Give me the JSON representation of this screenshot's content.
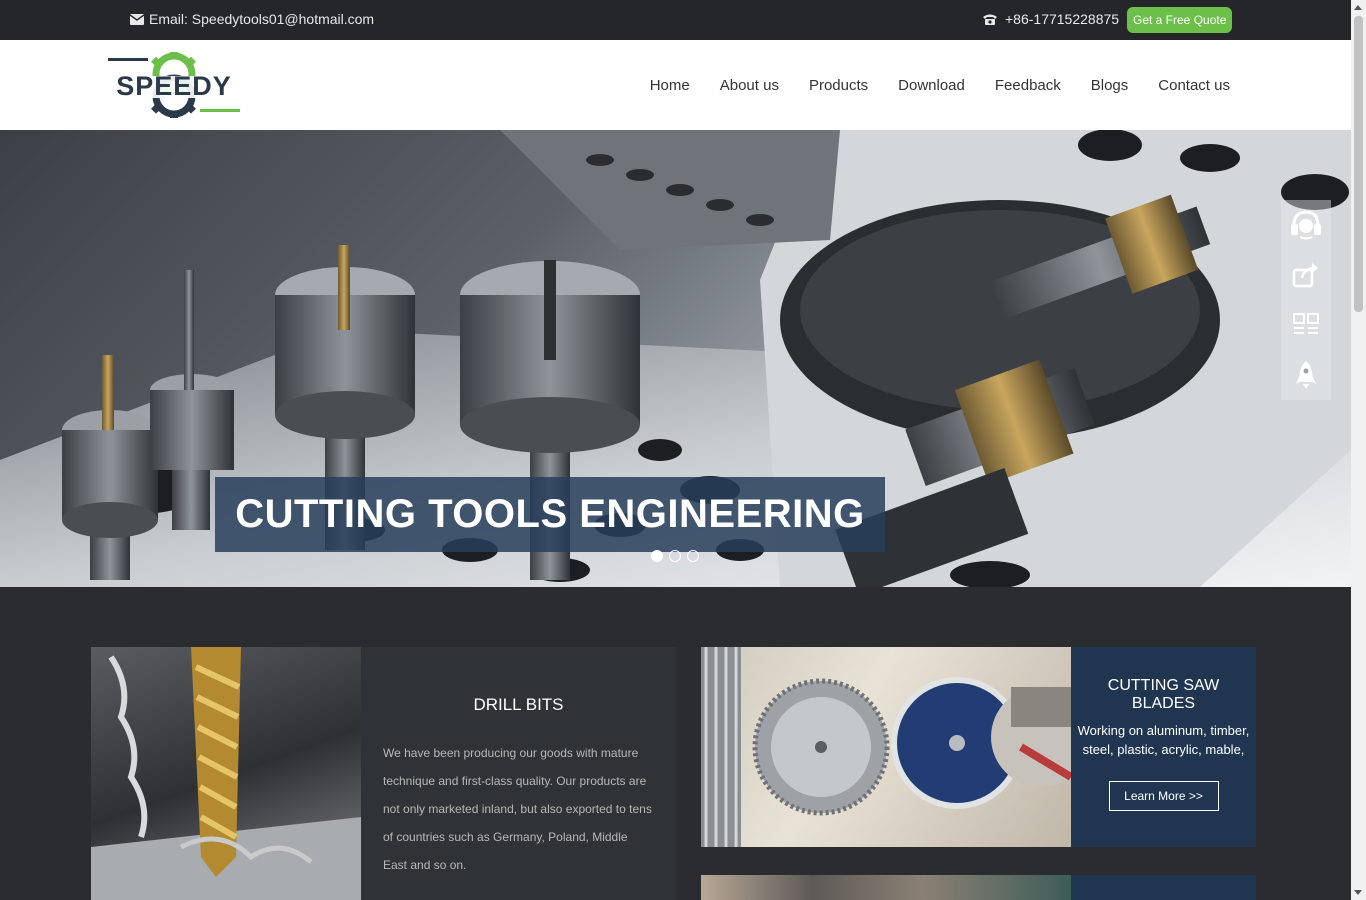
{
  "topbar": {
    "email_text": "Email: Speedytools01@hotmail.com",
    "phone": "+86-17715228875",
    "quote_label": "Get a Free Quote"
  },
  "header": {
    "logo_text": "SPEEDY",
    "nav": [
      {
        "label": "Home"
      },
      {
        "label": "About us"
      },
      {
        "label": "Products"
      },
      {
        "label": "Download"
      },
      {
        "label": "Feedback"
      },
      {
        "label": "Blogs"
      },
      {
        "label": "Contact us"
      }
    ]
  },
  "hero": {
    "caption": "CUTTING TOOLS ENGINEERING",
    "slides_total": 3,
    "active_slide": 1
  },
  "side_tools": [
    {
      "icon": "headset-icon"
    },
    {
      "icon": "share-icon"
    },
    {
      "icon": "qr-code-icon"
    },
    {
      "icon": "rocket-icon"
    }
  ],
  "products": [
    {
      "title": "DRILL BITS",
      "description": "We have been producing our goods with mature technique and first-class quality. Our products are not only marketed inland, but also exported to tens of countries such as Germany, Poland, Middle East and so on."
    },
    {
      "title": "CUTTING SAW BLADES",
      "description": "Working on aluminum, timber, steel, plastic, acrylic, mable,",
      "button_label": "Learn More >>"
    }
  ],
  "colors": {
    "topbar_bg": "#24262a",
    "quote_green": "#6cc04a",
    "logo_green": "#6cc04a",
    "logo_dark": "#2b3a4a",
    "caption_bg": "#283e5a",
    "card_blue": "#1f3550"
  }
}
